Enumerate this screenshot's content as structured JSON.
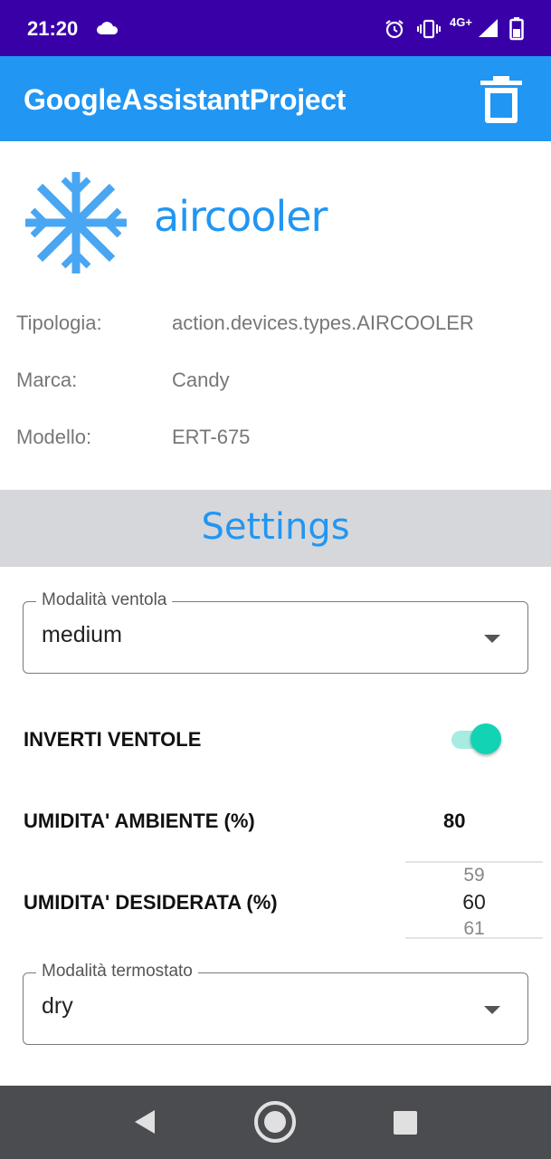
{
  "status_bar": {
    "time": "21:20",
    "network": "4G+",
    "icons": [
      "cloud-icon",
      "alarm-icon",
      "vibrate-icon",
      "signal-icon",
      "battery-icon"
    ]
  },
  "app_bar": {
    "title": "GoogleAssistantProject",
    "background": "#2196f3",
    "delete_icon": "trash-icon"
  },
  "device": {
    "name": "aircooler",
    "icon": "snowflake-icon",
    "accent": "#2196f3",
    "fields": [
      {
        "label": "Tipologia:",
        "value": "action.devices.types.AIRCOOLER"
      },
      {
        "label": "Marca:",
        "value": "Candy"
      },
      {
        "label": "Modello:",
        "value": "ERT-675"
      }
    ]
  },
  "settings": {
    "title": "Settings",
    "fan_mode": {
      "label": "Modalità ventola",
      "value": "medium"
    },
    "invert_fans": {
      "label": "INVERTI VENTOLE",
      "on": true
    },
    "ambient_humidity": {
      "label": "UMIDITA' AMBIENTE (%)",
      "value": "80"
    },
    "desired_humidity": {
      "label": "UMIDITA' DESIDERATA (%)",
      "prev": "59",
      "current": "60",
      "next": "61"
    },
    "thermostat_mode": {
      "label": "Modalità termostato",
      "value": "dry"
    }
  },
  "nav_bar": {
    "icons": [
      "back-icon",
      "home-icon",
      "recent-apps-icon"
    ]
  }
}
